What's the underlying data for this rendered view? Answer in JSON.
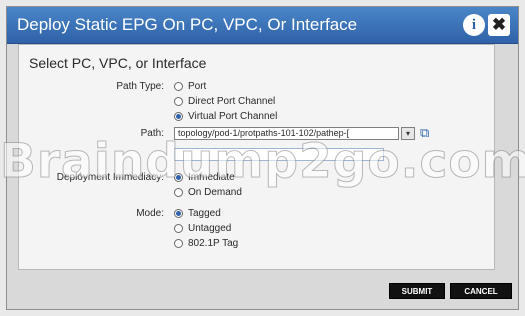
{
  "dialog": {
    "title": "Deploy Static EPG On PC, VPC, Or Interface",
    "info_icon_glyph": "i",
    "close_icon_glyph": "✖"
  },
  "panel": {
    "title": "Select PC, VPC, or Interface"
  },
  "path_type": {
    "label": "Path Type:",
    "options": [
      "Port",
      "Direct Port Channel",
      "Virtual Port Channel"
    ],
    "selected": "Virtual Port Channel"
  },
  "path": {
    "label": "Path:",
    "value": "topology/pod-1/protpaths-101-102/pathep-[",
    "dropdown_glyph": "▾",
    "link_glyph": "⧉"
  },
  "deployment_immediacy": {
    "label": "Deployment Immediacy:",
    "options": [
      "Immediate",
      "On Demand"
    ],
    "selected": "Immediate"
  },
  "mode": {
    "label": "Mode:",
    "options": [
      "Tagged",
      "Untagged",
      "802.1P Tag"
    ],
    "selected": "Tagged"
  },
  "watermark": {
    "text": "Braindump2go.com"
  },
  "footer": {
    "submit": "SUBMIT",
    "cancel": "CANCEL"
  },
  "colors": {
    "titlebar": "#2f62a8",
    "radio_selected": "#2f62a8"
  }
}
